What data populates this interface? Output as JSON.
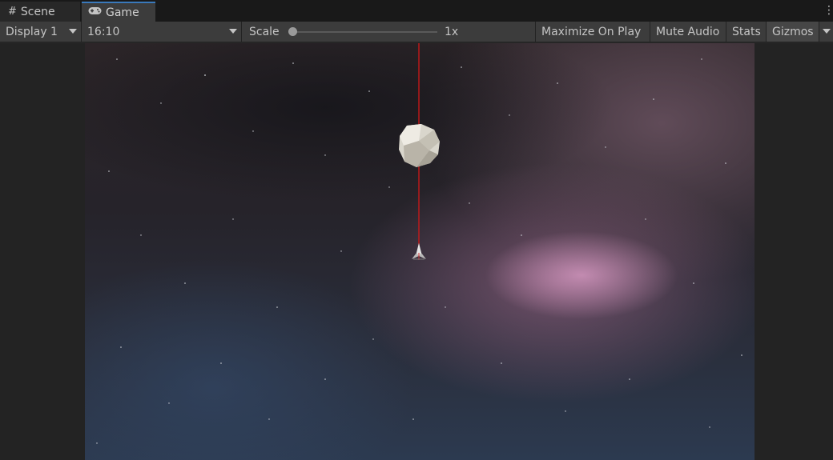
{
  "tabs": {
    "scene_label": "Scene",
    "game_label": "Game"
  },
  "toolbar": {
    "display_select": "Display 1",
    "aspect_select": "16:10",
    "scale_label": "Scale",
    "scale_value": "1x",
    "scale_slider_fraction": 0.0,
    "maximize_on_play": "Maximize On Play",
    "mute_audio": "Mute Audio",
    "stats": "Stats",
    "gizmos": "Gizmos"
  },
  "icons": {
    "scene_tab": "grid-icon",
    "game_tab": "gamepad-icon",
    "menu": "kebab-menu-icon",
    "dropdown": "chevron-down-icon"
  },
  "colors": {
    "active_tab_accent": "#3a79bb",
    "laser": "#d01818"
  }
}
